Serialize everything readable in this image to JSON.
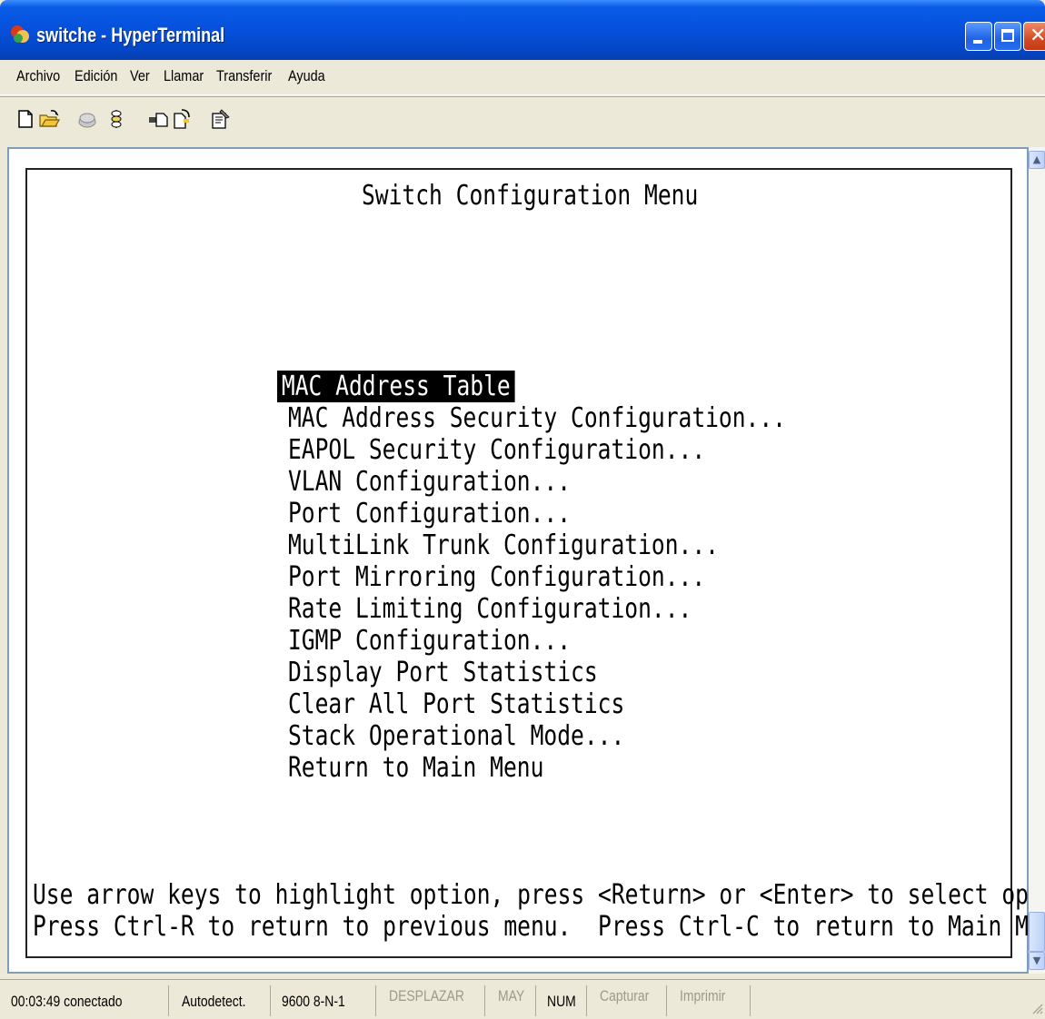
{
  "window": {
    "title": "switche - HyperTerminal",
    "app_icon": "hyperterminal-icon"
  },
  "menubar": {
    "items": [
      "Archivo",
      "Edición",
      "Ver",
      "Llamar",
      "Transferir",
      "Ayuda"
    ]
  },
  "toolbar": {
    "icons": [
      "new-connection-icon",
      "open-icon",
      "disconnect-icon",
      "dial-icon",
      "send-icon",
      "receive-icon",
      "properties-icon"
    ]
  },
  "terminal": {
    "title": "Switch Configuration Menu",
    "selected_item": "MAC Address Table",
    "menu_items": [
      "MAC Address Table",
      "MAC Address Security Configuration...",
      "EAPOL Security Configuration...",
      "VLAN Configuration...",
      "Port Configuration...",
      "MultiLink Trunk Configuration...",
      "Port Mirroring Configuration...",
      "Rate Limiting Configuration...",
      "IGMP Configuration...",
      "Display Port Statistics",
      "Clear All Port Statistics",
      "Stack Operational Mode...",
      "Return to Main Menu"
    ],
    "footer_line_1": "Use arrow keys to highlight option, press <Return> or <Enter> to select option.",
    "footer_line_2": "Press Ctrl-R to return to previous menu.  Press Ctrl-C to return to Main Menu._"
  },
  "statusbar": {
    "connection": "00:03:49 conectado",
    "detect": "Autodetect.",
    "settings": "9600 8-N-1",
    "scroll": "DESPLAZAR",
    "caps": "MAY",
    "num": "NUM",
    "capture": "Capturar",
    "print": "Imprimir"
  }
}
